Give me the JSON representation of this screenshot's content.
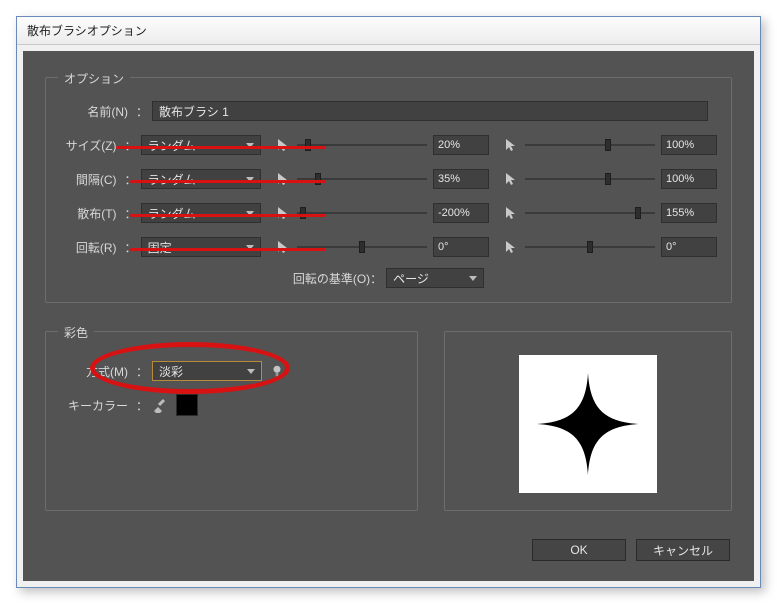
{
  "window": {
    "title": "散布ブラシオプション"
  },
  "options": {
    "group_title": "オプション",
    "name_label": "名前(N)",
    "name_value": "散布ブラシ 1",
    "rows": [
      {
        "label": "サイズ(Z)",
        "mode": "ランダム",
        "v1": "20%",
        "v2": "100%",
        "t1": 8,
        "t2": 80
      },
      {
        "label": "間隔(C)",
        "mode": "ランダム",
        "v1": "35%",
        "v2": "100%",
        "t1": 18,
        "t2": 80
      },
      {
        "label": "散布(T)",
        "mode": "ランダム",
        "v1": "-200%",
        "v2": "155%",
        "t1": 3,
        "t2": 110
      },
      {
        "label": "回転(R)",
        "mode": "固定",
        "v1": "0°",
        "v2": "0°",
        "t1": 62,
        "t2": 62
      }
    ],
    "rotation_basis_label": "回転の基準(O)",
    "rotation_basis_value": "ページ"
  },
  "color": {
    "group_title": "彩色",
    "method_label": "方式(M)",
    "method_value": "淡彩",
    "key_label": "キーカラー"
  },
  "buttons": {
    "ok": "OK",
    "cancel": "キャンセル"
  }
}
